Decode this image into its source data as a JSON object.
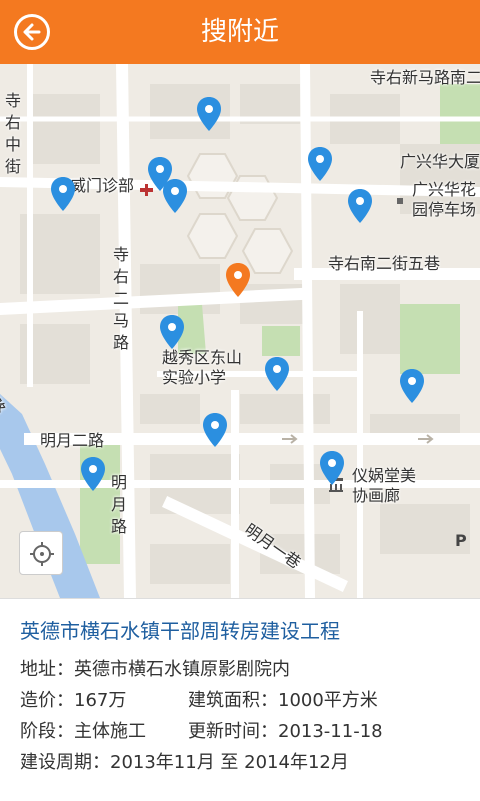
{
  "header": {
    "title": "搜附近"
  },
  "map": {
    "labels": {
      "street_top_right": "寺右新马路南二",
      "street_left_vertical": "寺右中街",
      "clinic": "威门诊部",
      "guangxing_building": "广兴华大厦",
      "parking_lot": "广兴华花园停车场",
      "lane_five": "寺右南二街五巷",
      "street_second_vertical": "寺右二马路",
      "school": "越秀区东山实验小学",
      "mingyue_road": "明月二路",
      "mingyue_road_vertical": "明月路",
      "gallery": "仪娲堂美协画廊",
      "mingyue_lane": "明月一巷",
      "left_edge": "路"
    },
    "parking_symbol": "P",
    "pin_count_blue": 11,
    "pin_count_orange": 1,
    "colors": {
      "blue_pin": "#2b8fe0",
      "orange_pin": "#f47920",
      "road": "#ffffff",
      "block": "#e4e0d8",
      "park": "#c5dfb2",
      "water": "#a8c8ec"
    }
  },
  "project": {
    "title": "英德市横石水镇干部周转房建设工程",
    "address_label": "地址：",
    "address": "英德市横石水镇原影剧院内",
    "cost_label": "造价：",
    "cost": "167万",
    "area_label": "建筑面积：",
    "area": "1000平方米",
    "stage_label": "阶段：",
    "stage": "主体施工",
    "updated_label": "更新时间：",
    "updated": "2013-11-18",
    "period_label": "建设周期：",
    "period": "2013年11月 至 2014年12月"
  },
  "icons": {
    "back": "back-arrow-icon",
    "locate": "locate-crosshair-icon"
  }
}
